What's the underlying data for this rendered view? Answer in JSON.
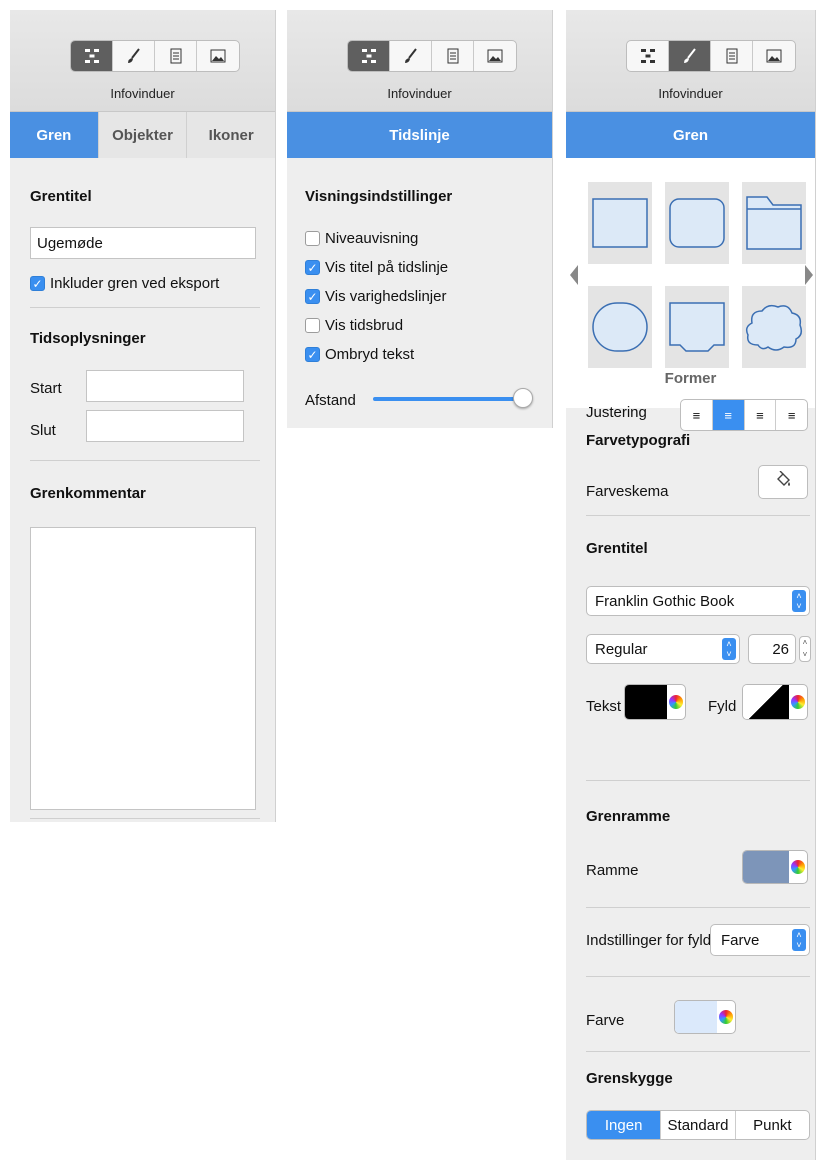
{
  "panel1": {
    "toolbar_caption": "Infovinduer",
    "tabs": [
      "Gren",
      "Objekter",
      "Ikoner"
    ],
    "branch_title_heading": "Grentitel",
    "branch_title_value": "Ugemøde",
    "include_export_label": "Inkluder gren ved eksport",
    "time_heading": "Tidsoplysninger",
    "start_label": "Start",
    "end_label": "Slut",
    "comment_heading": "Grenkommentar"
  },
  "panel2": {
    "toolbar_caption": "Infovinduer",
    "tab": "Tidslinje",
    "display_heading": "Visningsindstillinger",
    "options": [
      {
        "label": "Niveauvisning",
        "checked": false
      },
      {
        "label": "Vis titel på tidslinje",
        "checked": true
      },
      {
        "label": "Vis varighedslinjer",
        "checked": true
      },
      {
        "label": "Vis tidsbrud",
        "checked": false
      },
      {
        "label": "Ombryd tekst",
        "checked": true
      }
    ],
    "spacing_label": "Afstand",
    "spacing_value": 1.0
  },
  "panel3": {
    "toolbar_caption": "Infovinduer",
    "tab": "Gren",
    "shapes_label": "Former",
    "color_typo_heading": "Farvetypografi",
    "color_scheme_label": "Farveskema",
    "branch_title_heading": "Grentitel",
    "font_name": "Franklin Gothic Book",
    "font_style": "Regular",
    "font_size": "26",
    "text_label": "Tekst",
    "fill_label": "Fyld",
    "align_label": "Justering",
    "border_heading": "Grenramme",
    "border_label": "Ramme",
    "fill_settings_label": "Indstillinger for fyld",
    "fill_settings_value": "Farve",
    "color_label": "Farve",
    "shadow_heading": "Grenskygge",
    "shadow_options": [
      "Ingen",
      "Standard",
      "Punkt"
    ],
    "colors": {
      "accent": "#4a90e2",
      "border_swatch": "#7d95b9",
      "fill_swatch": "#dbe9fb",
      "shape_fill": "#dce9f7",
      "shape_stroke": "#3b6fb3"
    }
  }
}
